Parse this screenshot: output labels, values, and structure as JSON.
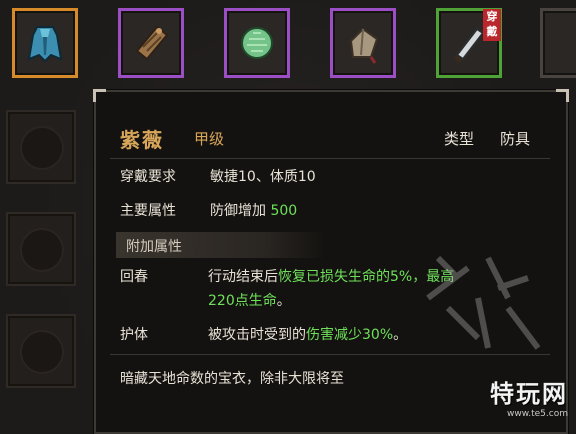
{
  "item": {
    "name": "紫薇",
    "grade": "甲级",
    "type_label": "类型",
    "type_value": "防具",
    "equip_requirement_label": "穿戴要求",
    "equip_requirement_value": "敏捷10、体质10",
    "main_attr_label": "主要属性",
    "main_attr_text": "防御增加",
    "main_attr_value": "500",
    "extra_section_title": "附加属性",
    "extra_attrs": [
      {
        "name": "回春",
        "line1_prefix": "行动结束后",
        "line1_green": "恢复已损失生命的5%，最高",
        "line2_green": "220点生命",
        "line2_suffix": "。"
      },
      {
        "name": "护体",
        "prefix": "被攻击时受到的",
        "green": "伤害减少30%",
        "suffix": "。"
      }
    ],
    "description": "暗藏天地命数的宝衣，除非大限将至"
  },
  "slots": [
    {
      "icon": "cloak-icon",
      "rarity": "orange"
    },
    {
      "icon": "scroll-icon",
      "rarity": "purple"
    },
    {
      "icon": "jade-orb-icon",
      "rarity": "purple"
    },
    {
      "icon": "pouch-icon",
      "rarity": "purple"
    },
    {
      "icon": "blade-icon",
      "rarity": "green",
      "badge": "穿戴"
    }
  ],
  "watermark": {
    "brand": "特玩网",
    "url": "www.te5.com"
  },
  "colors": {
    "name_gold": "#d8a65a",
    "highlight_green": "#6ee05a",
    "rarity_orange": "#d78a2a",
    "rarity_purple": "#9c4fc5",
    "rarity_green": "#4fa235"
  }
}
